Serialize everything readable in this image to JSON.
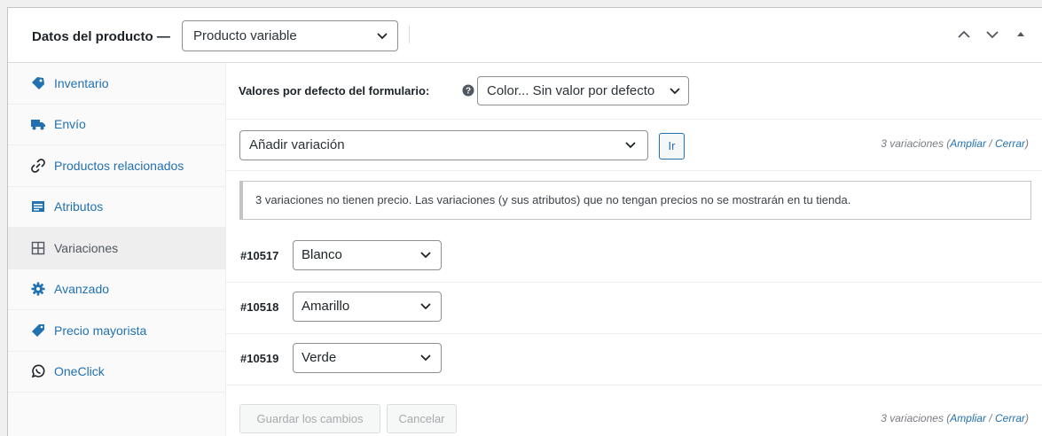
{
  "header": {
    "title": "Datos del producto —",
    "product_type": "Producto variable"
  },
  "sidebar": {
    "items": [
      {
        "label": "Inventario",
        "icon": "tag-icon"
      },
      {
        "label": "Envío",
        "icon": "truck-icon"
      },
      {
        "label": "Productos relacionados",
        "icon": "link-icon"
      },
      {
        "label": "Atributos",
        "icon": "list-icon"
      },
      {
        "label": "Variaciones",
        "icon": "grid-icon",
        "active": true
      },
      {
        "label": "Avanzado",
        "icon": "gear-icon"
      },
      {
        "label": "Precio mayorista",
        "icon": "price-tag-icon"
      },
      {
        "label": "OneClick",
        "icon": "whatsapp-icon"
      }
    ]
  },
  "defaults": {
    "label": "Valores por defecto del formulario:",
    "select_value": "Color... Sin valor por defecto"
  },
  "add_variation": {
    "select_value": "Añadir variación",
    "go_label": "Ir",
    "count_text": "3 variaciones (",
    "expand": "Ampliar",
    "slash": " / ",
    "close": "Cerrar",
    "close_paren": ")"
  },
  "notice": "3 variaciones no tienen precio. Las variaciones (y sus atributos) que no tengan precios no se mostrarán en tu tienda.",
  "variations": [
    {
      "id": "#10517",
      "value": "Blanco"
    },
    {
      "id": "#10518",
      "value": "Amarillo"
    },
    {
      "id": "#10519",
      "value": "Verde"
    }
  ],
  "footer": {
    "save_label": "Guardar los cambios",
    "cancel_label": "Cancelar",
    "count_text": "3 variaciones (",
    "expand": "Ampliar",
    "slash": " / ",
    "close": "Cerrar",
    "close_paren": ")"
  },
  "colors": {
    "link": "#2271b1",
    "border": "#c3c4c7",
    "text": "#1d2327"
  }
}
